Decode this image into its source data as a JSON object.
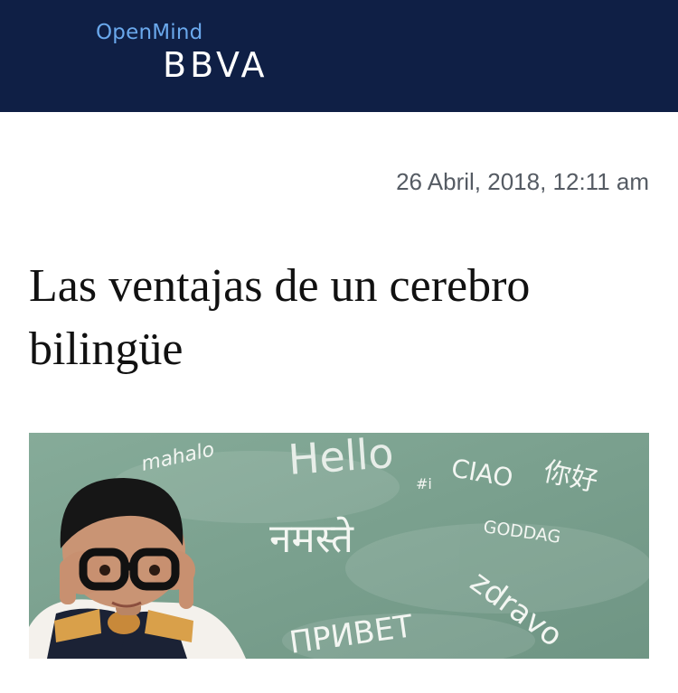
{
  "header": {
    "brand_sub": "OpenMind",
    "brand_main": "BBVA",
    "background_color": "#0f1f45",
    "brand_sub_color": "#6aa8ec"
  },
  "article": {
    "date": "26 Abril, 2018, 12:11 am",
    "title": "Las ventajas de un cerebro bilingüe"
  },
  "hero_image": {
    "chalk_words": {
      "mahalo": "mahalo",
      "hello": "Hello",
      "ciao": "CIAO",
      "nihao": "你好",
      "hi": "#i",
      "namaste": "नमस्ते",
      "goddag": "GODDAG",
      "zdravo": "zdravo",
      "privet": "ПРИВЕТ"
    },
    "board_color": "#7fa593",
    "chalk_color": "#f3f6f2"
  }
}
